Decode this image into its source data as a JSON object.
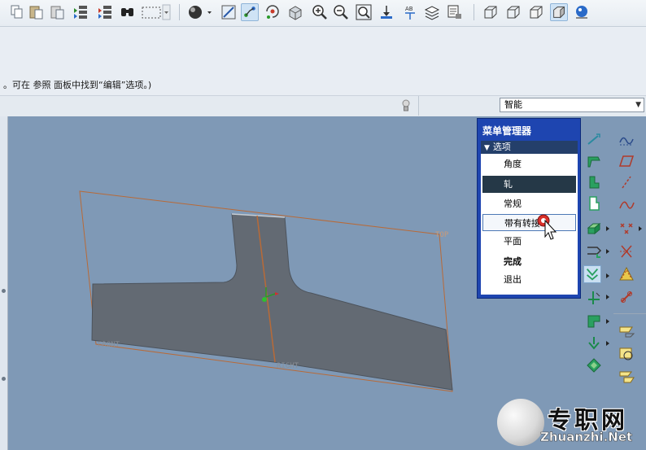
{
  "message": "。可在 参照 面板中找到“编辑”选项。)",
  "filter": {
    "value": "智能"
  },
  "menu_manager": {
    "title": "菜单管理器",
    "section": "选项",
    "items": [
      {
        "label": "角度",
        "state": "normal"
      },
      {
        "label": "轧",
        "state": "selected"
      },
      {
        "label": "常规",
        "state": "normal"
      },
      {
        "label": "带有转接",
        "state": "hover"
      },
      {
        "label": "平面",
        "state": "normal"
      },
      {
        "label": "完成",
        "state": "bold"
      },
      {
        "label": "退出",
        "state": "normal"
      }
    ]
  },
  "datum_labels": {
    "top": "TOP",
    "front": "FRONT",
    "right": "RIGHT"
  },
  "watermark": {
    "text": "专职网",
    "url": "Zhuanzhi.Net"
  },
  "colors": {
    "graphics_bg": "#7f99b6",
    "part": "#636a73",
    "datum": "#b86a38",
    "menu_title": "#1e45b0",
    "selected_item": "#253847"
  },
  "toolbar_icons": [
    "copy-icon",
    "paste-icon",
    "paste-special-icon",
    "regenerate-icon",
    "regen-manager-icon",
    "find-icon",
    "select-box-icon",
    "shading-icon",
    "repaint-icon",
    "datum-display-icon",
    "spin-center-icon",
    "orient-icon",
    "zoom-in-icon",
    "zoom-out-icon",
    "refit-icon",
    "reorient-icon",
    "saved-views-icon",
    "layers-icon",
    "view-manager-icon",
    "wireframe-icon",
    "hidden-line-icon",
    "no-hidden-icon",
    "shaded-icon",
    "model-tree-icon"
  ],
  "feature_toolbar_icons": [
    "datum-axis-icon",
    "sketched-curve-icon",
    "datum-plane-icon",
    "datum-point-icon",
    "coord-sys-icon",
    "sketch-icon",
    "shell-icon",
    "curve-icon",
    "round-icon",
    "draft-icon",
    "extrude-icon",
    "revolve-icon",
    "rib-icon",
    "blend-icon",
    "hole-icon",
    "pattern-icon",
    "copy-feature-icon",
    "mirror-icon",
    "merge-icon",
    "sweep-icon",
    "cross-section-icon",
    "intersect-icon",
    "trim-icon",
    "offset-icon"
  ]
}
